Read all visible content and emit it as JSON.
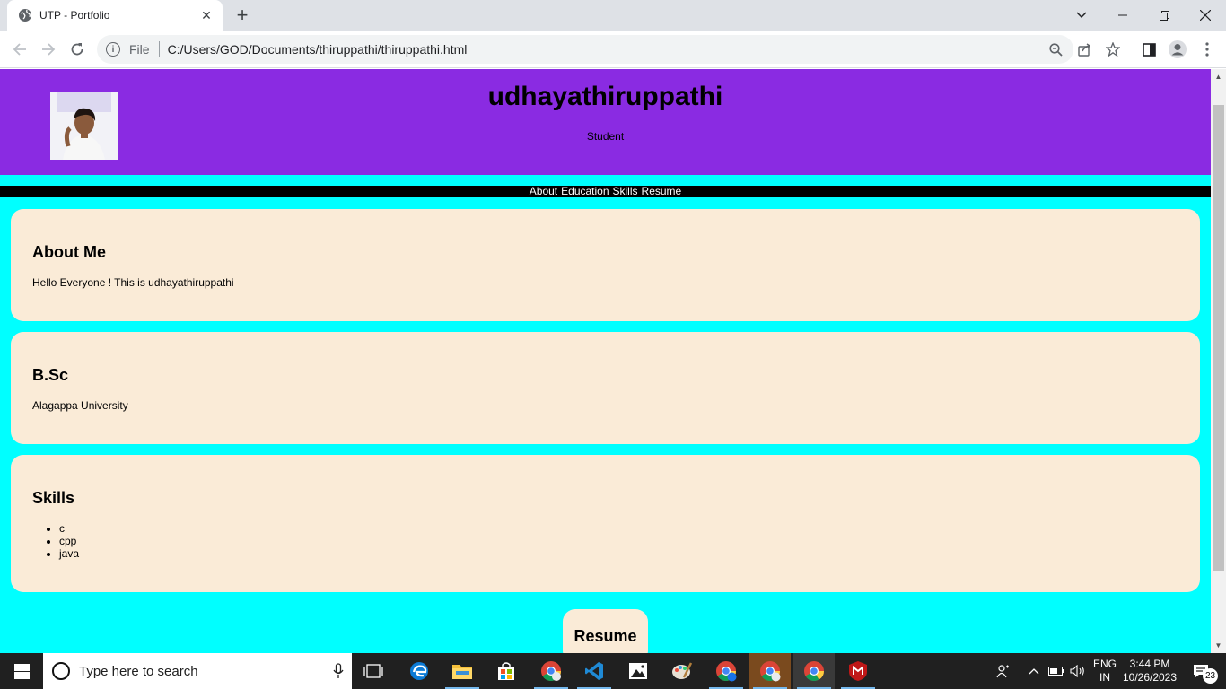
{
  "browser": {
    "tab_title": "UTP - Portfolio",
    "new_tab_symbol": "+",
    "address_scheme_label": "File",
    "url": "C:/Users/GOD/Documents/thiruppathi/thiruppathi.html"
  },
  "page": {
    "header": {
      "name": "udhayathiruppathi",
      "role": "Student"
    },
    "nav": {
      "items": [
        "About",
        "Education",
        "Skills",
        "Resume"
      ]
    },
    "about": {
      "heading": "About Me",
      "text": "Hello Everyone ! This is udhayathiruppathi"
    },
    "education": {
      "degree": "B.Sc",
      "institution": "Alagappa University"
    },
    "skills": {
      "heading": "Skills",
      "items": [
        "c",
        "cpp",
        "java"
      ]
    },
    "resume": {
      "heading": "Resume"
    },
    "colors": {
      "header_bg": "#8a2be2",
      "page_bg": "#00ffff",
      "card_bg": "#faebd7",
      "nav_bg": "#000000"
    }
  },
  "taskbar": {
    "search_placeholder": "Type here to search",
    "language_primary": "ENG",
    "language_secondary": "IN",
    "time": "3:44 PM",
    "date": "10/26/2023",
    "notification_count": "23"
  }
}
